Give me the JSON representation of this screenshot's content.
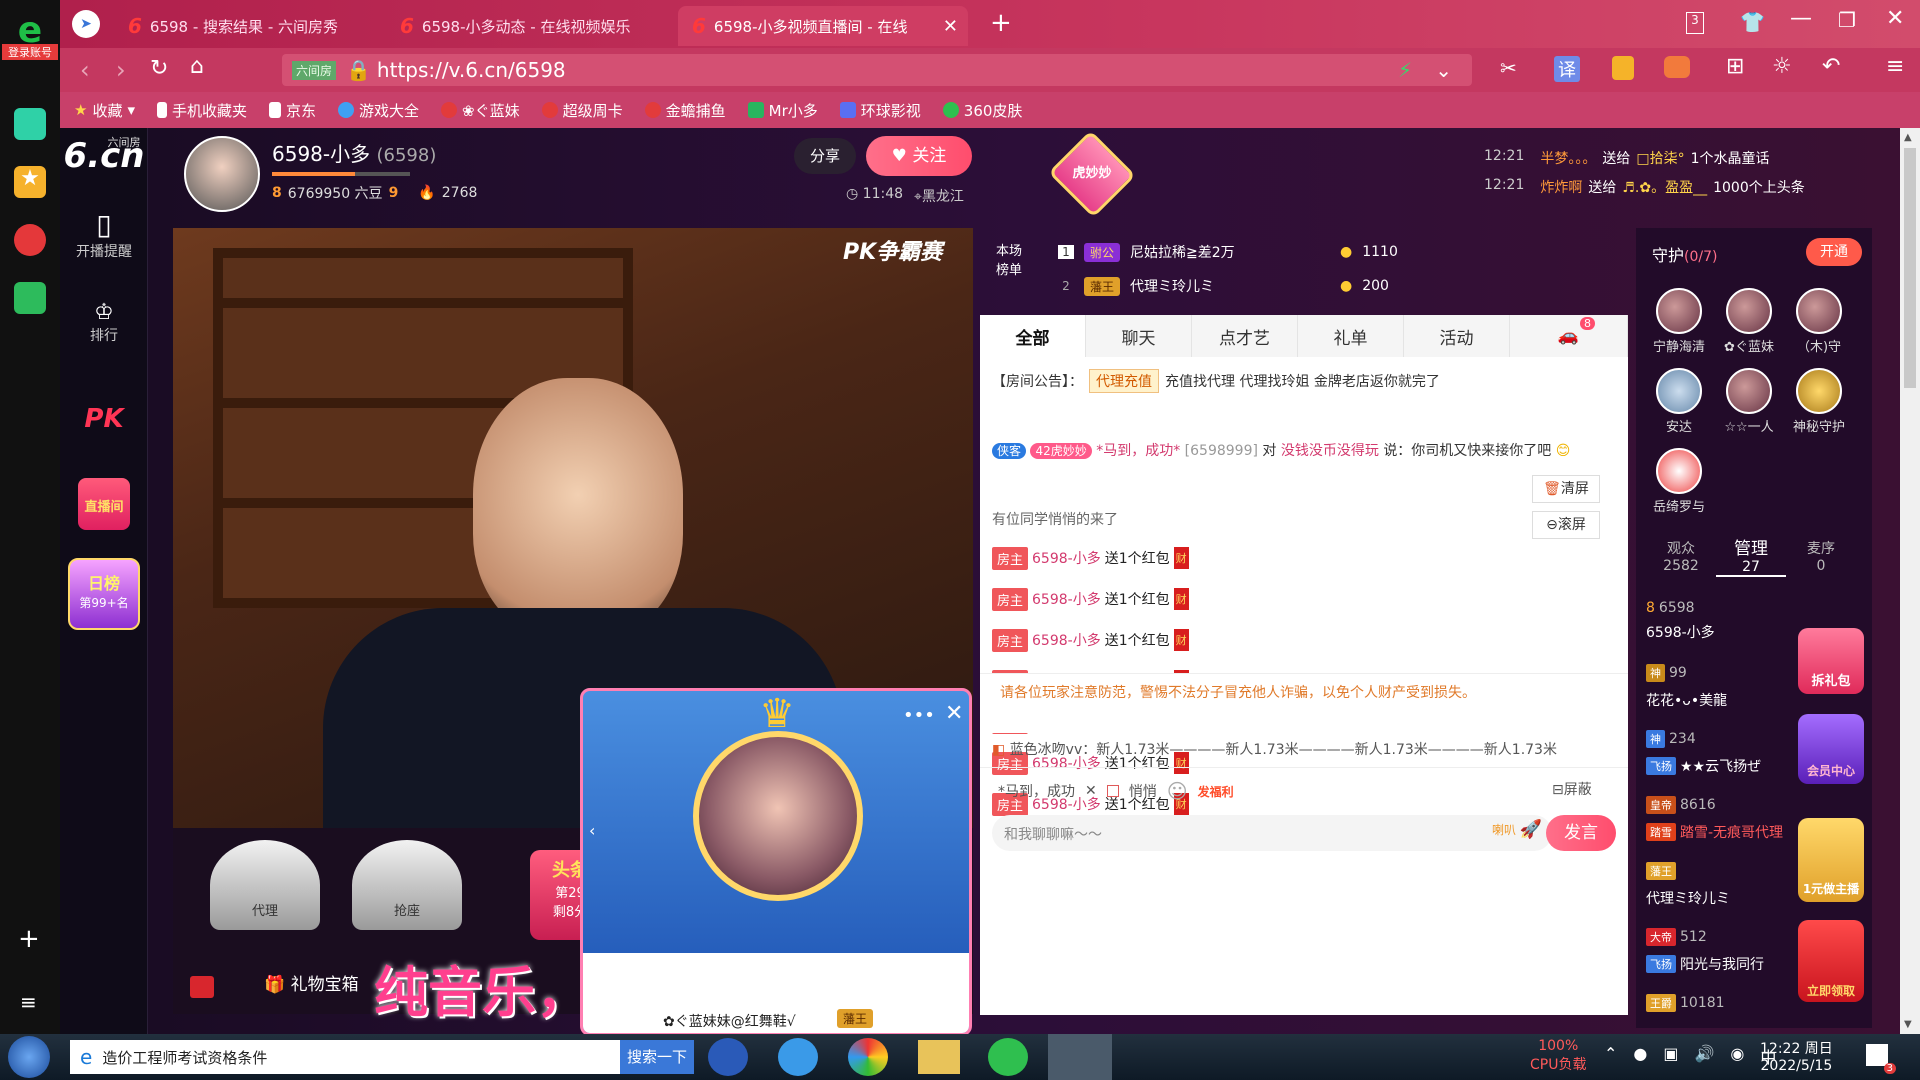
{
  "left_sidebar": {
    "login": "登录账号"
  },
  "tabs": [
    {
      "label": "6598 - 搜索结果 - 六间房秀",
      "active": false
    },
    {
      "label": "6598-小多动态 - 在线视频娱乐",
      "active": false
    },
    {
      "label": "6598-小多视频直播间 - 在线",
      "active": true
    }
  ],
  "window": {
    "tab_count": "3"
  },
  "address": {
    "url": "https://v.6.cn/6598",
    "site_tag": "六间房"
  },
  "bookmarks": [
    "收藏",
    "手机收藏夹",
    "京东",
    "游戏大全",
    "❀ぐ蓝妹",
    "超级周卡",
    "金蟾捕鱼",
    "Mr小多",
    "环球影视",
    "360皮肤"
  ],
  "site_nav": {
    "logo": "6.cn",
    "logo_sub": "六间房",
    "remind": "开播提醒",
    "rank": "排行",
    "pk": "PK",
    "live": "直播间",
    "day_rank": "日榜",
    "day_rank_pos": "第99+名"
  },
  "streamer": {
    "name": "6598-小多",
    "id": "(6598)",
    "level": "8",
    "beans": "6769950 六豆",
    "rich_level": "9",
    "fans": "2768",
    "share": "分享",
    "follow": "关注",
    "time": "11:48",
    "location": "黑龙江",
    "pet": "虎妙妙"
  },
  "gift_feed": [
    {
      "time": "12:21",
      "from": "半梦。。。",
      "verb": "送给",
      "to": "□拾柒°",
      "gift": "1个水晶童话"
    },
    {
      "time": "12:21",
      "from": "炸炸啊",
      "verb": "送给",
      "to": "♬.✿。盈盈__",
      "gift": "1000个上头条"
    }
  ],
  "video": {
    "pk_label": "PK争霸赛",
    "seat1": "代理",
    "seat2": "抢座",
    "headline": "头条",
    "headline_rank": "第29",
    "headline_sub": "剩8分",
    "gift_box": "礼物宝箱",
    "overlay_text": "纯音乐，请欣赏",
    "mini_user": "✿ぐ蓝妹妹@红舞鞋√",
    "mini_badge": "藩王"
  },
  "rank": {
    "label": "本场榜单",
    "rows": [
      {
        "n": "1",
        "tag": "驸公",
        "name": "尼姑拉稀≧差2万",
        "coins": "1110"
      },
      {
        "n": "2",
        "tag": "藩王",
        "name": "代理ミ玲儿ミ",
        "coins": "200"
      }
    ]
  },
  "chat": {
    "tabs": [
      "全部",
      "聊天",
      "点才艺",
      "礼单",
      "活动"
    ],
    "car_badge": "8",
    "notice_label": "【房间公告】：",
    "notice_tag": "代理充值",
    "notice_text": "充值找代理 代理找玲姐 金牌老店返你就完了",
    "msg1_badge": "侠客",
    "msg1_level": "42",
    "msg1_pet": "虎妙妙",
    "msg1_user": "*马到，成功*",
    "msg1_id": "[6598999]",
    "msg1_to": "对",
    "msg1_target": "没钱没币没得玩",
    "msg1_text": "说：你司机又快来接你了吧",
    "quiet": "有位同学悄悄的来了",
    "clear": "清屏",
    "scroll": "滚屏",
    "red_rows": [
      {
        "tag": "房主",
        "user": "6598-小多",
        "text": "送1个红包",
        "icon": "财"
      },
      {
        "tag": "房主",
        "user": "6598-小多",
        "text": "送1个红包",
        "icon": "财"
      },
      {
        "tag": "房主",
        "user": "6598-小多",
        "text": "送1个红包",
        "icon": "财"
      },
      {
        "tag": "房主",
        "user": "6598-小多",
        "text": "送1个红包",
        "icon": "财"
      },
      {
        "tag": "房主",
        "user": "6598-小多",
        "text": "送1个红包",
        "icon": "财"
      },
      {
        "tag": "房主",
        "user": "6598-小多",
        "text": "送1个红包",
        "icon": "财"
      },
      {
        "tag": "房主",
        "user": "6598-小多",
        "text": "送1个红包",
        "icon": "财"
      }
    ],
    "warning": "请各位玩家注意防范，警惕不法分子冒充他人诈骗，以免个人财产受到损失。",
    "marquee_user": "蓝色冰吻vv：",
    "marquee_text": "新人1.73米————新人1.73米————新人1.73米————新人1.73米",
    "target_user": "*马到，成功",
    "whisper": "悄悄",
    "fuli": "发福利",
    "block": "屏蔽",
    "placeholder": "和我聊聊嘛～～",
    "send": "发言",
    "horn": "喇叭"
  },
  "guard": {
    "title": "守护",
    "count": "(0/7)",
    "open": "开通",
    "members": [
      "宁静海清",
      "✿ぐ蓝妹",
      "（木)守",
      "安达",
      "☆☆一人",
      "神秘守护",
      "岳绮罗与"
    ],
    "tabs": [
      {
        "label": "观众",
        "n": "2582"
      },
      {
        "label": "管理",
        "n": "27"
      },
      {
        "label": "麦序",
        "n": "0"
      }
    ],
    "users": [
      {
        "badge": "8",
        "name": "6598-小多",
        "num": "6598"
      },
      {
        "badge": "神",
        "name": "花花•ᴗ•美龍",
        "num": "99"
      },
      {
        "badge": "神",
        "name": "★★云飞扬ぜ",
        "num": "234",
        "sub": "飞扬"
      },
      {
        "badge": "皇帝",
        "name": "踏雪-无痕哥代理",
        "num": "8616",
        "sub": "踏雪"
      },
      {
        "badge": "藩王",
        "name": "代理ミ玲儿ミ",
        "num": ""
      },
      {
        "badge": "大帝",
        "name": "阳光与我同行",
        "num": "512",
        "sub": "飞扬"
      },
      {
        "badge": "王爵",
        "name": "",
        "num": "10181"
      }
    ],
    "btn_gift": "拆礼包",
    "btn_member": "会员中心",
    "btn_anchor": "1元做主播",
    "btn_claim": "立即领取"
  },
  "taskbar": {
    "doc": "造价工程师考试资格条件",
    "search": "搜索一下",
    "cpu": "100%",
    "cpu_label": "CPU负载",
    "time": "12:22 周日",
    "date": "2022/5/15",
    "notif": "3"
  },
  "colors": {
    "accent": "#ff4d6d",
    "chrome": "#c43860"
  }
}
